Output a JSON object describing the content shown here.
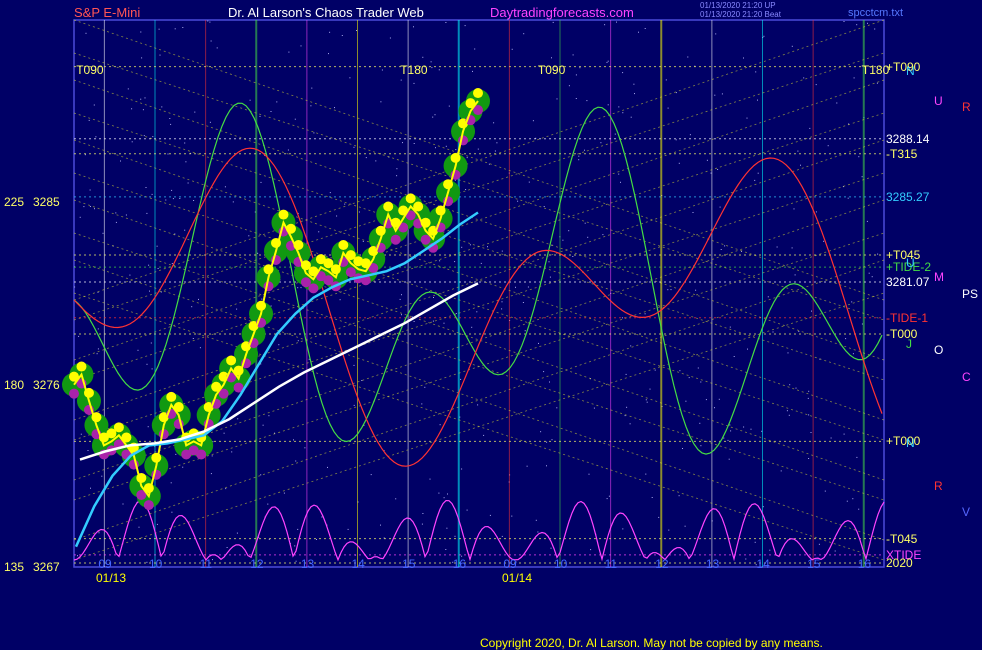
{
  "header": {
    "symbol": "S&P E-Mini",
    "title": "Dr. Al Larson's Chaos Trader Web",
    "site": "Daytradingforecasts.com",
    "stamp_line1": "01/13/2020 21:20 UP",
    "stamp_line2": "01/13/2020 21:20 Beat",
    "file": "spcctcm.txt"
  },
  "footer": {
    "copyright": "Copyright 2020, Dr. Al Larson. May not be copied by any means."
  },
  "colors": {
    "background": "#000066",
    "frame": "#4a4ad8",
    "price": "#ffff00",
    "red": "#ff3333",
    "green": "#44dd44",
    "cyan": "#33ccff",
    "magenta": "#ff44ff",
    "white": "#ffffff"
  },
  "chart_data": {
    "type": "line",
    "title": "Dr. Al Larson's Chaos Trader Web",
    "y_range": [
      3267,
      3294
    ],
    "left_axis": [
      {
        "angle": "225",
        "price": "3285",
        "value": 3285
      },
      {
        "angle": "180",
        "price": "3276",
        "value": 3276
      },
      {
        "angle": "135",
        "price": "3267",
        "value": 3267
      }
    ],
    "right_labels": [
      {
        "text": "+T090",
        "value": 3291.7,
        "color": "#ffff66"
      },
      {
        "text": "3288.14",
        "value": 3288.14,
        "color": "#ffffff"
      },
      {
        "text": "-T315",
        "value": 3287.4,
        "color": "#ffff66"
      },
      {
        "text": "3285.27",
        "value": 3285.27,
        "color": "#33ccff"
      },
      {
        "text": "+T045",
        "value": 3282.4,
        "color": "#ffff66"
      },
      {
        "text": "+TIDE-2",
        "value": 3281.8,
        "color": "#44dd44"
      },
      {
        "text": "3281.07",
        "value": 3281.07,
        "color": "#ffffff"
      },
      {
        "text": "-TIDE-1",
        "value": 3279.3,
        "color": "#ff3333"
      },
      {
        "text": "-T000",
        "value": 3278.5,
        "color": "#ffff66"
      },
      {
        "text": "+T000",
        "value": 3273.2,
        "color": "#ffff66"
      },
      {
        "text": "-T045",
        "value": 3268.4,
        "color": "#ffff66"
      },
      {
        "text": "XTIDE",
        "value": 3267.6,
        "color": "#ff44ff"
      },
      {
        "text": "2020",
        "value": 3267.2,
        "color": "#ffff66"
      }
    ],
    "planet_markers": [
      {
        "text": "N",
        "value": 3291.5,
        "color": "#33ccff"
      },
      {
        "text": "U",
        "value": 3290,
        "color": "#ff44ff"
      },
      {
        "text": "R",
        "value": 3289.7,
        "color": "#ff3333"
      },
      {
        "text": "U",
        "value": 3282,
        "color": "#33ccff"
      },
      {
        "text": "M",
        "value": 3281.3,
        "color": "#ff44ff"
      },
      {
        "text": "PS",
        "value": 3280.5,
        "color": "#ffffff"
      },
      {
        "text": "J",
        "value": 3278,
        "color": "#44dd44"
      },
      {
        "text": "O",
        "value": 3277.7,
        "color": "#ffffff"
      },
      {
        "text": "C",
        "value": 3276.4,
        "color": "#ff44ff"
      },
      {
        "text": "N",
        "value": 3273.1,
        "color": "#33ccff"
      },
      {
        "text": "R",
        "value": 3271,
        "color": "#ff3333"
      },
      {
        "text": "V",
        "value": 3269.7,
        "color": "#5566ff"
      }
    ],
    "top_labels": [
      {
        "text": "T090",
        "pos": 0.02
      },
      {
        "text": "T180",
        "pos": 0.42
      },
      {
        "text": "T090",
        "pos": 0.59
      },
      {
        "text": "T180",
        "pos": 0.99
      }
    ],
    "x_ticks": [
      "09",
      "10",
      "11",
      "12",
      "13",
      "14",
      "15",
      "16",
      "09",
      "10",
      "11",
      "12",
      "13",
      "14",
      "15",
      "16"
    ],
    "dates": [
      "01/13",
      "01/14"
    ],
    "price_series": [
      3276,
      3276.5,
      3275.2,
      3274,
      3273,
      3273.2,
      3273.5,
      3273,
      3272.5,
      3271,
      3270.5,
      3272,
      3274,
      3275,
      3274.5,
      3273,
      3273.2,
      3273,
      3274.5,
      3275.5,
      3276,
      3276.8,
      3276.3,
      3277.5,
      3278.5,
      3279.5,
      3281.3,
      3282.6,
      3284,
      3283.3,
      3282.5,
      3281.5,
      3281.2,
      3281.8,
      3281.6,
      3281.3,
      3282.5,
      3282,
      3281.7,
      3281.6,
      3282.2,
      3283.2,
      3284.4,
      3283.6,
      3284.2,
      3284.8,
      3284.4,
      3283.6,
      3283.2,
      3284.2,
      3285.5,
      3286.8,
      3288.5,
      3289.5,
      3290
    ],
    "mov_avg_cyan": [
      3268,
      3270,
      3271.5,
      3272.5,
      3273,
      3273.1,
      3273.3,
      3273.5,
      3274.2,
      3275.5,
      3277,
      3278.5,
      3279.5,
      3280.3,
      3280.8,
      3281.2,
      3281.4,
      3281.6,
      3282,
      3282.6,
      3283.2,
      3283.9,
      3284.5
    ],
    "mov_avg_white": [
      3272.3,
      3272.7,
      3273,
      3273.1,
      3273.3,
      3273.7,
      3274.3,
      3275.1,
      3275.9,
      3276.6,
      3277.2,
      3277.8,
      3278.4,
      3279,
      3279.7,
      3280.4,
      3281
    ]
  }
}
